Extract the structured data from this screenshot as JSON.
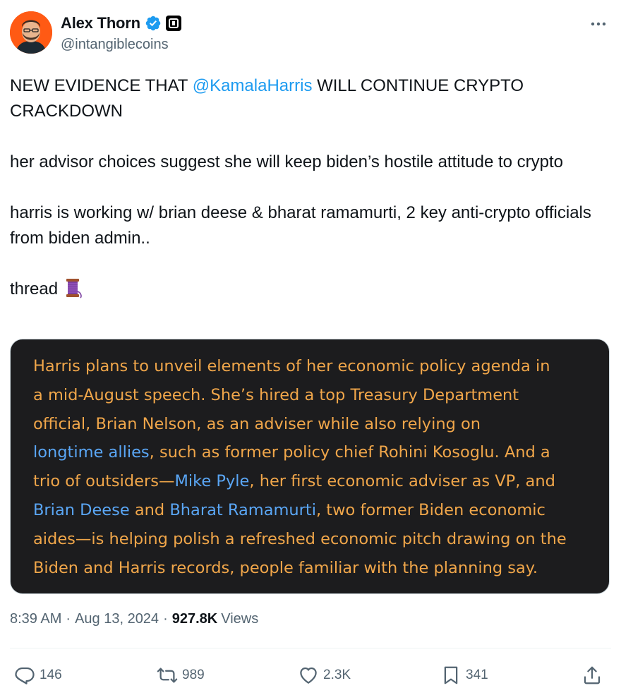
{
  "author": {
    "display_name": "Alex Thorn",
    "handle": "@intangiblecoins",
    "verified": true,
    "accent_color": "#1d9bf0",
    "avatar_bg": "#ff5a14"
  },
  "tweet": {
    "line1_prefix": "NEW EVIDENCE THAT ",
    "mention": "@KamalaHarris",
    "line1_suffix": " WILL CONTINUE CRYPTO CRACKDOWN",
    "paragraph2": "her advisor choices suggest she will keep biden’s hostile attitude to crypto",
    "paragraph3": "harris is working w/ brian deese & bharat ramamurti, 2 key anti-crypto officials from biden admin..",
    "paragraph4": "thread",
    "thread_icon": "spool-of-thread-icon"
  },
  "media": {
    "l1": "Harris plans to unveil elements of her economic policy agenda in",
    "l2": "a mid-August speech. She’s hired a top Treasury Department",
    "l3": "official, Brian Nelson, as an adviser while also relying on",
    "l4_link": "longtime allies",
    "l4_rest": ", such as former policy chief Rohini Kosoglu. And a",
    "l5_pre": "trio of outsiders—",
    "l5_link": "Mike Pyle",
    "l5_post": ", her first economic adviser as VP, and",
    "l6_link1": "Brian Deese",
    "l6_mid": " and ",
    "l6_link2": "Bharat Ramamurti",
    "l6_post": ", two former Biden economic",
    "l7": "aides—is helping polish a refreshed economic pitch drawing on the",
    "l8": "Biden and Harris records, people familiar with the planning say.",
    "text_color": "#f0a64a",
    "link_color": "#5aa6f5",
    "bg_color": "#1c1c1e"
  },
  "meta": {
    "time": "8:39 AM",
    "date": "Aug 13, 2024",
    "views_count": "927.8K",
    "views_label": "Views"
  },
  "actions": {
    "replies": "146",
    "reposts": "989",
    "likes": "2.3K",
    "bookmarks": "341"
  }
}
